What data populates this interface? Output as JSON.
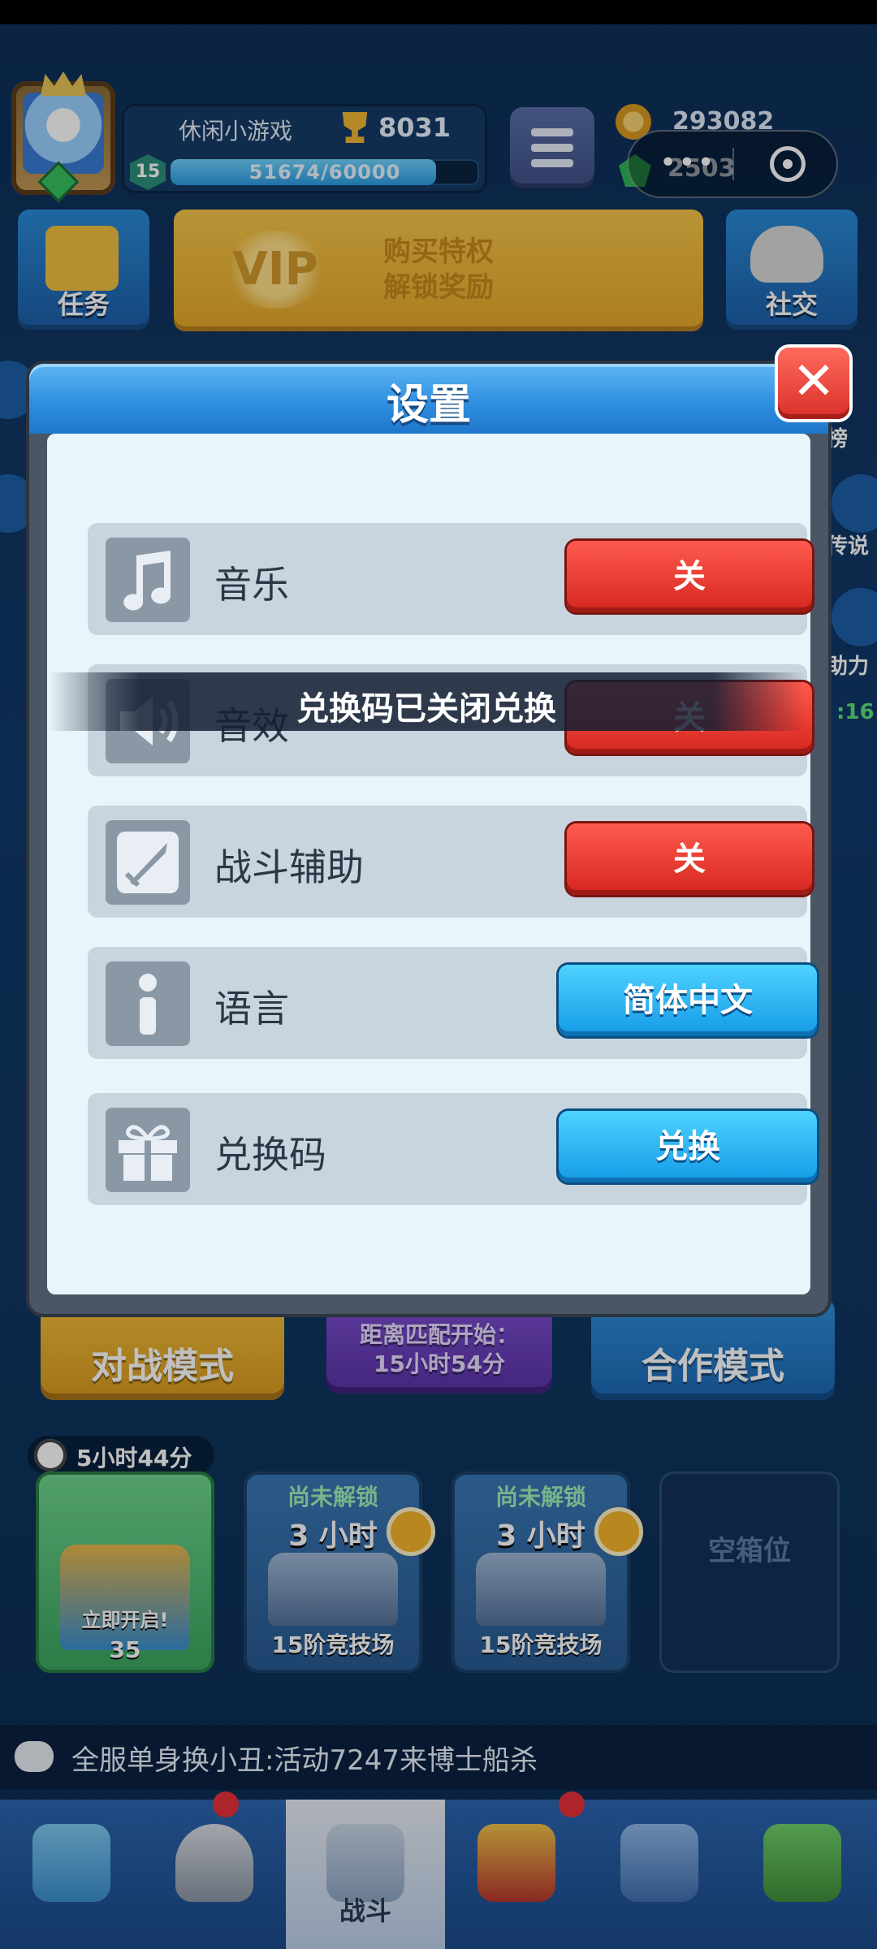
{
  "header": {
    "player_name": "休闲小游戏",
    "trophies": "8031",
    "level": "15",
    "xp_text": "51674/60000",
    "xp_fraction": 0.8612,
    "coins": "293082",
    "gems": "2503"
  },
  "capsule": {
    "dots": "•••"
  },
  "top_buttons": {
    "task": "任务",
    "vip_line1": "购买特权",
    "vip_line2": "解锁奖励",
    "vip_logo": "VIP",
    "social": "社交"
  },
  "edge_labels": {
    "right_1": "榜",
    "right_2": "传说",
    "right_3": "助力",
    "right_4": ":16"
  },
  "modes": {
    "battle": "对战模式",
    "match_line1": "距离匹配开始：",
    "match_line2": "15小时54分",
    "coop": "合作模式"
  },
  "chest_timer": "5小时44分",
  "chest_slots": [
    {
      "top": "",
      "time": "",
      "bottom": "立即开启!",
      "cost": "35"
    },
    {
      "top": "尚未解锁",
      "time": "3 小时",
      "bottom": "15阶竞技场"
    },
    {
      "top": "尚未解锁",
      "time": "3 小时",
      "bottom": "15阶竞技场"
    },
    {
      "top": "空箱位",
      "time": "",
      "bottom": ""
    }
  ],
  "ticker": "全服单身换小丑:活动7247来博士船杀",
  "tabs": {
    "battle": "战斗"
  },
  "settings": {
    "title": "设置",
    "close": "✕",
    "rows": [
      {
        "icon": "music-note-icon",
        "label": "音乐",
        "button": "关"
      },
      {
        "icon": "speaker-icon",
        "label": "音效",
        "button": "关"
      },
      {
        "icon": "sword-icon",
        "label": "战斗辅助",
        "button": "关"
      },
      {
        "icon": "info-icon",
        "label": "语言",
        "button": "简体中文"
      },
      {
        "icon": "gift-icon",
        "label": "兑换码",
        "button": "兑换"
      }
    ]
  },
  "toast": "兑换码已关闭兑换",
  "colors": {
    "toggle_off_red": "#e23a30",
    "action_blue": "#1fa7ee",
    "header_blue": "#2f8fe0"
  }
}
